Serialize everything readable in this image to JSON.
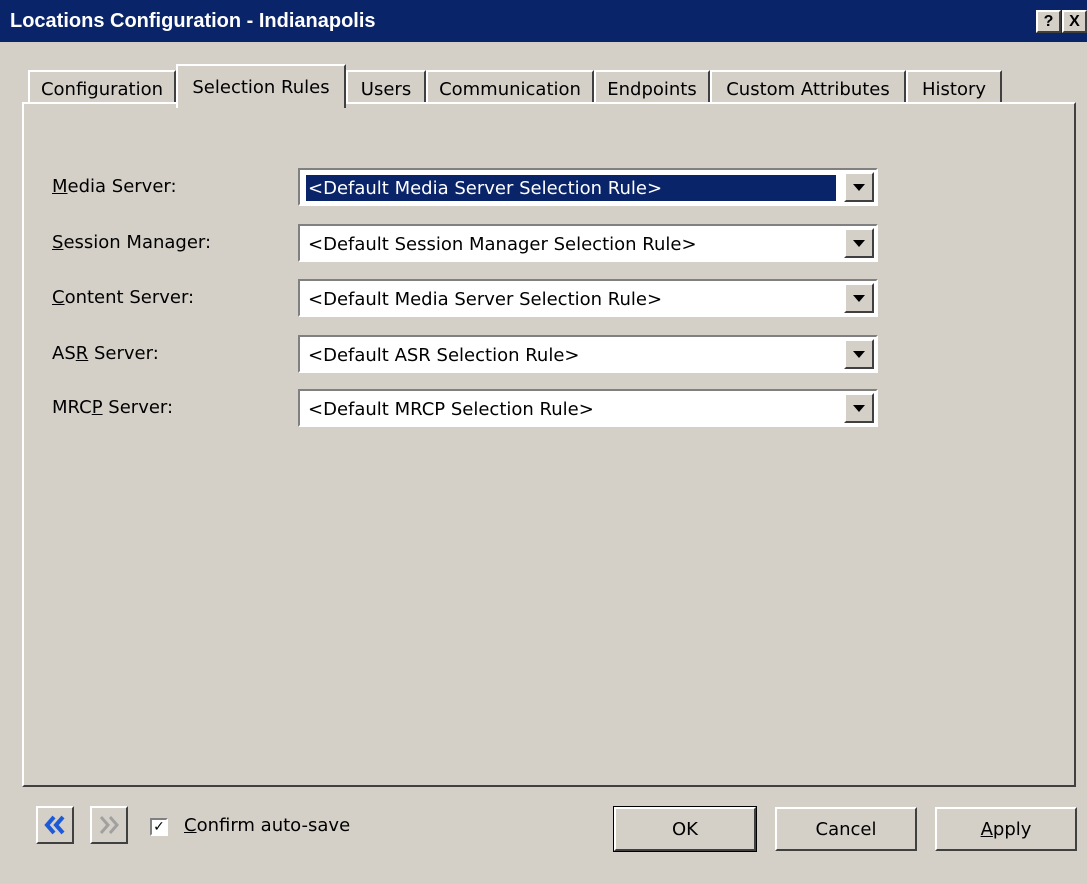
{
  "window": {
    "title": "Locations Configuration - Indianapolis",
    "help_label": "?",
    "close_label": "X"
  },
  "tabs": [
    {
      "label": "Configuration",
      "active": false
    },
    {
      "label": "Selection Rules",
      "active": true
    },
    {
      "label": "Users",
      "active": false
    },
    {
      "label": "Communication",
      "active": false
    },
    {
      "label": "Endpoints",
      "active": false
    },
    {
      "label": "Custom Attributes",
      "active": false
    },
    {
      "label": "History",
      "active": false
    }
  ],
  "rules": [
    {
      "label_pre": "",
      "label_ul": "M",
      "label_post": "edia Server:",
      "value": "<Default Media Server Selection Rule>",
      "focused": true
    },
    {
      "label_pre": "",
      "label_ul": "S",
      "label_post": "ession Manager:",
      "value": "<Default Session Manager Selection Rule>",
      "focused": false
    },
    {
      "label_pre": "",
      "label_ul": "C",
      "label_post": "ontent Server:",
      "value": "<Default Media Server Selection Rule>",
      "focused": false
    },
    {
      "label_pre": "AS",
      "label_ul": "R",
      "label_post": " Server:",
      "value": "<Default ASR Selection Rule>",
      "focused": false
    },
    {
      "label_pre": "MRC",
      "label_ul": "P",
      "label_post": " Server:",
      "value": "<Default MRCP Selection Rule>",
      "focused": false
    }
  ],
  "footer": {
    "prev_icon": "double-chevron-left-icon",
    "next_icon": "double-chevron-right-icon",
    "confirm_checked": true,
    "confirm_ul": "C",
    "confirm_rest": "onfirm auto-save",
    "ok_label": "OK",
    "cancel_label": "Cancel",
    "apply_ul": "A",
    "apply_rest": "pply"
  },
  "colors": {
    "titlebar": "#0a246a",
    "face": "#d4d0c8",
    "nav_active": "#1c5ad8",
    "nav_disabled": "#a0a0a0"
  }
}
